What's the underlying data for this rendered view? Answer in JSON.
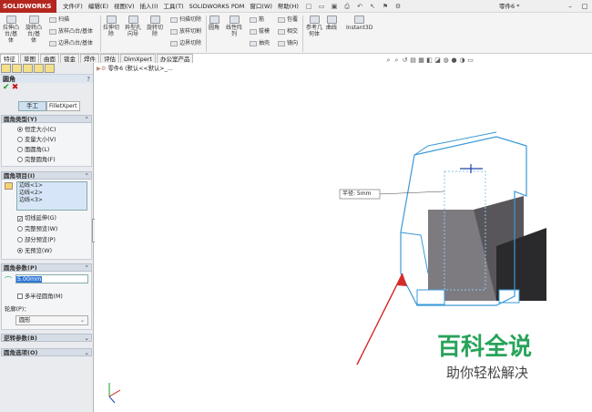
{
  "app": {
    "logo": "SOLIDWORKS",
    "doc_title": "零件6 *"
  },
  "menu": [
    "文件(F)",
    "编辑(E)",
    "视图(V)",
    "插入(I)",
    "工具(T)",
    "SOLIDWORKS PDM",
    "窗口(W)",
    "帮助(H)"
  ],
  "ribbon": {
    "big": [
      {
        "label": "拉伸凸\n台/基\n体"
      },
      {
        "label": "旋转凸\n台/基\n体"
      },
      {
        "label": "拉伸切\n除"
      },
      {
        "label": "异型孔\n向导"
      },
      {
        "label": "旋转切\n除"
      },
      {
        "label": "圆角"
      },
      {
        "label": "线性阵\n列"
      },
      {
        "label": "参考几\n何体"
      },
      {
        "label": "曲线"
      },
      {
        "label": "Instant3D"
      }
    ],
    "small": [
      "扫描",
      "放样凸台/基体",
      "边界凸台/基体",
      "扫描切除",
      "放样切割",
      "边界切除",
      "筋",
      "拔模",
      "抽壳",
      "包覆",
      "相交",
      "镜向"
    ]
  },
  "tabs": [
    "特征",
    "草图",
    "曲面",
    "钣金",
    "焊件",
    "评估",
    "DimXpert",
    "办公室产品"
  ],
  "panel": {
    "title": "圆角",
    "help": "?",
    "mode_tabs": [
      "手工",
      "FilletXpert"
    ],
    "sections": {
      "type": {
        "title": "圆角类型(Y)",
        "options": [
          "恒定大小(C)",
          "变量大小(V)",
          "面圆角(L)",
          "完整圆角(F)"
        ],
        "selected": 0
      },
      "items": {
        "title": "圆角项目(I)",
        "edges": [
          "边线<1>",
          "边线<2>",
          "边线<3>"
        ],
        "tangent": "切线延伸(G)",
        "preview": [
          "完整预览(W)",
          "部分预览(P)",
          "无预览(W)"
        ],
        "preview_selected": 2
      },
      "params": {
        "title": "圆角参数(P)",
        "value": "5.00mm",
        "multi": "多半径圆角(M)",
        "profile_label": "轮廓(P)：",
        "profile_value": "圆形"
      },
      "setback": {
        "title": "逆转参数(B)"
      },
      "options": {
        "title": "圆角选项(O)"
      }
    }
  },
  "viewport": {
    "tree_item": "零件6 (默认<<默认>_...",
    "dim_label": "半径: 5mm"
  },
  "watermark": {
    "line1": "百科全说",
    "line2": "助你轻松解决"
  }
}
